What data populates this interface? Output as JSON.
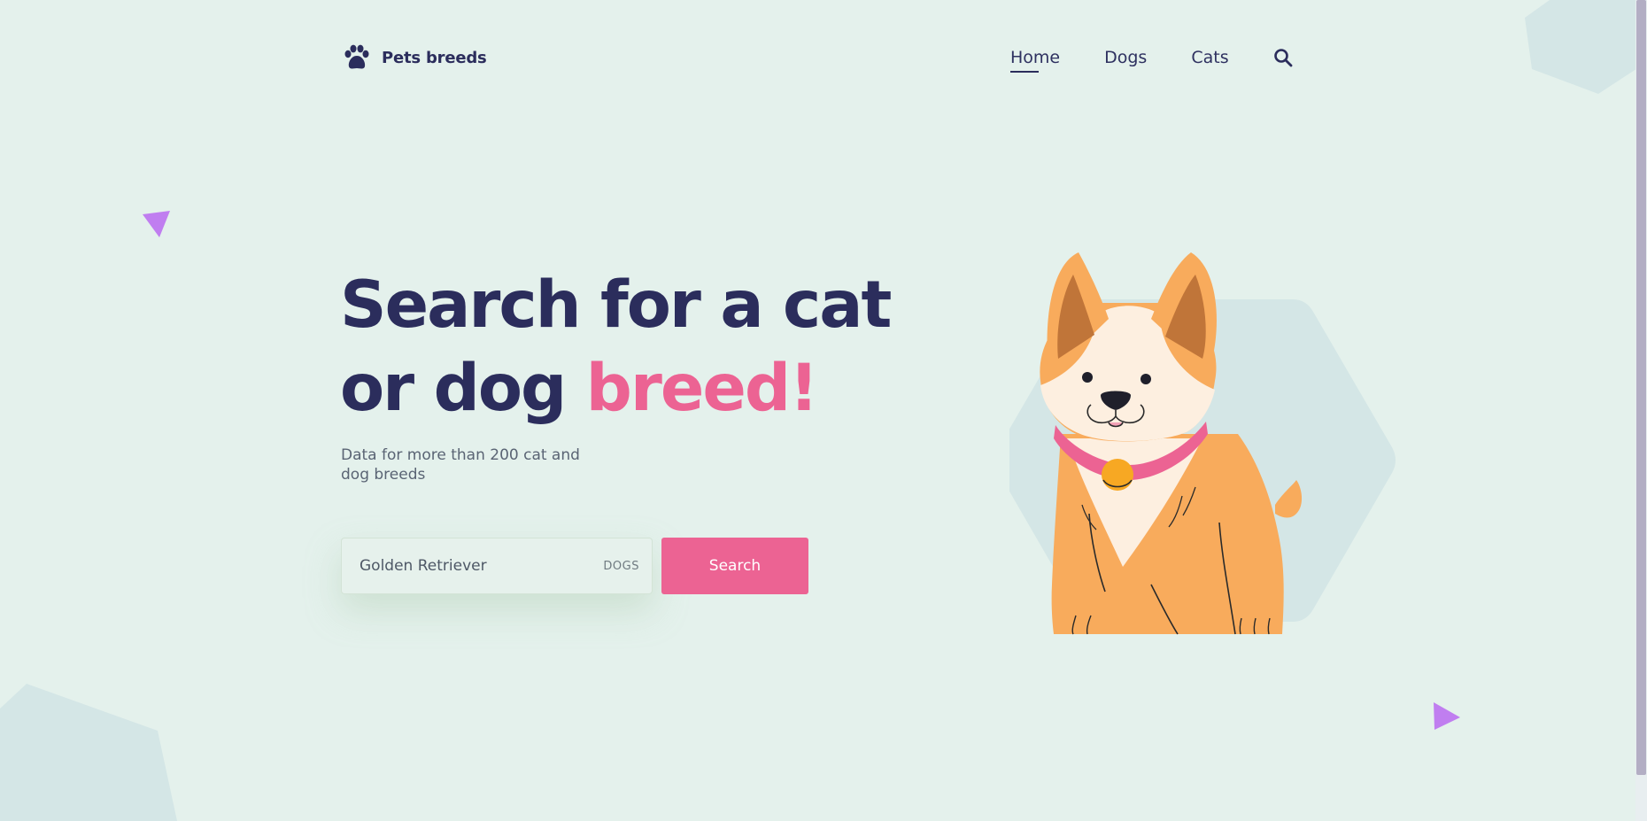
{
  "brand": {
    "name": "Pets breeds",
    "icon": "paw-icon"
  },
  "nav": {
    "items": [
      {
        "label": "Home",
        "active": true
      },
      {
        "label": "Dogs",
        "active": false
      },
      {
        "label": "Cats",
        "active": false
      }
    ],
    "search_icon": "search-icon"
  },
  "hero": {
    "title_line1": "Search for a cat",
    "title_line2_start": "or dog ",
    "title_accent": "breed!",
    "subtitle": "Data for more than 200 cat and dog breeds"
  },
  "search": {
    "value": "Golden Retriever",
    "tag": "DOGS",
    "button_label": "Search"
  },
  "colors": {
    "background": "#e4f1ec",
    "primary_text": "#2b2d5c",
    "accent": "#ec6393",
    "triangle": "#c07ef0",
    "shape": "#d4e6e6"
  }
}
